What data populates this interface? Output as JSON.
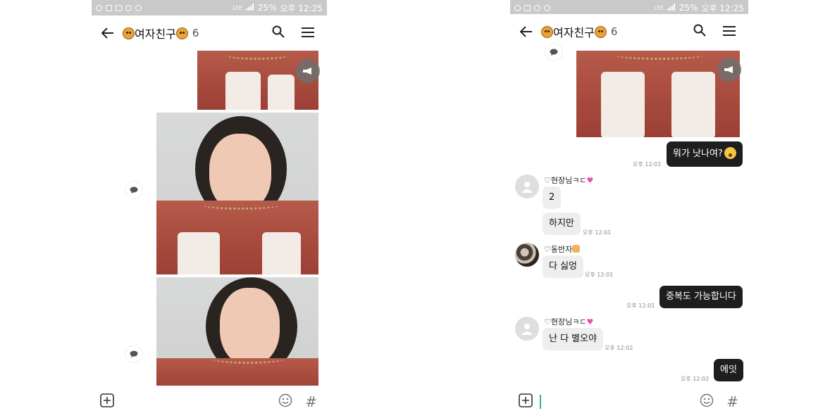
{
  "status_bar": {
    "left": {
      "battery": "25%",
      "time": "오후 12:25"
    },
    "right": {
      "battery": "25%",
      "time": "오후 12:25"
    },
    "network": "LTE"
  },
  "header": {
    "title": "여자친구",
    "member_count": "6"
  },
  "left_screen": {
    "items": [
      {
        "type": "image",
        "icon": "share-icon"
      },
      {
        "type": "image",
        "icon": "comment-icon"
      },
      {
        "type": "image",
        "icon": "comment-icon"
      }
    ]
  },
  "right_screen": {
    "messages": [
      {
        "type": "image",
        "icon": "share-icon"
      },
      {
        "direction": "out",
        "text": "뭐가 낫나여?",
        "time": "오후 12:01"
      },
      {
        "direction": "in",
        "sender": "♡현장님ㅋㄷ",
        "text": "2"
      },
      {
        "direction": "in",
        "text": "하지만",
        "time": "오후 12:01"
      },
      {
        "direction": "in",
        "sender": "♡동반자",
        "text": "다 싫엉",
        "time": "오후 12:01"
      },
      {
        "direction": "out",
        "text": "중복도 가능합니다",
        "time": "오후 12:01"
      },
      {
        "direction": "in",
        "sender": "♡현장님ㅋㄷ",
        "text": "난 다 별오야",
        "time": "오후 12:02"
      },
      {
        "direction": "out",
        "text": "에잇",
        "time": "오후 12:02"
      }
    ]
  },
  "input_bar": {
    "hash_label": "#"
  },
  "colors": {
    "accent": "#25b6a5",
    "out_bubble": "#1e1e1e",
    "in_bubble": "#eeeeee",
    "status_bar": "#c9c9c9"
  }
}
